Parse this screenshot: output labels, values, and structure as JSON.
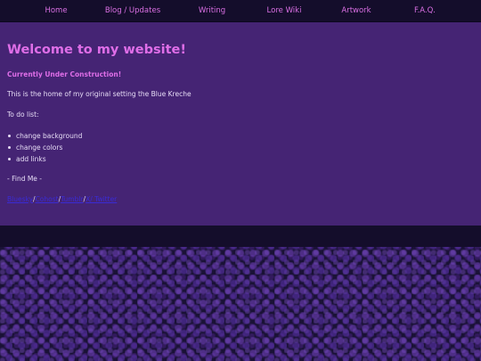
{
  "nav": {
    "items": [
      {
        "label": "Home"
      },
      {
        "label": "Blog / Updates"
      },
      {
        "label": "Writing"
      },
      {
        "label": "Lore Wiki"
      },
      {
        "label": "Artwork"
      },
      {
        "label": "F.A.Q."
      }
    ]
  },
  "main": {
    "title": "Welcome to my website!",
    "subtitle": "Currently Under Construction!",
    "intro": "This is the home of my original setting the Blue Kreche",
    "todo_heading": "To do list:",
    "todo_items": [
      "change background",
      "change colors",
      "add links"
    ],
    "find_me": "- Find Me -",
    "links": [
      {
        "label": "Bluesky"
      },
      {
        "label": "Cohost"
      },
      {
        "label": "Tumblr"
      },
      {
        "label": "X/ Twitter"
      }
    ],
    "link_separator": "/"
  },
  "colors": {
    "accent": "#df6ee8",
    "content_bg": "#452474",
    "nav_bg": "#140d2b",
    "link": "#3a2bd6"
  }
}
